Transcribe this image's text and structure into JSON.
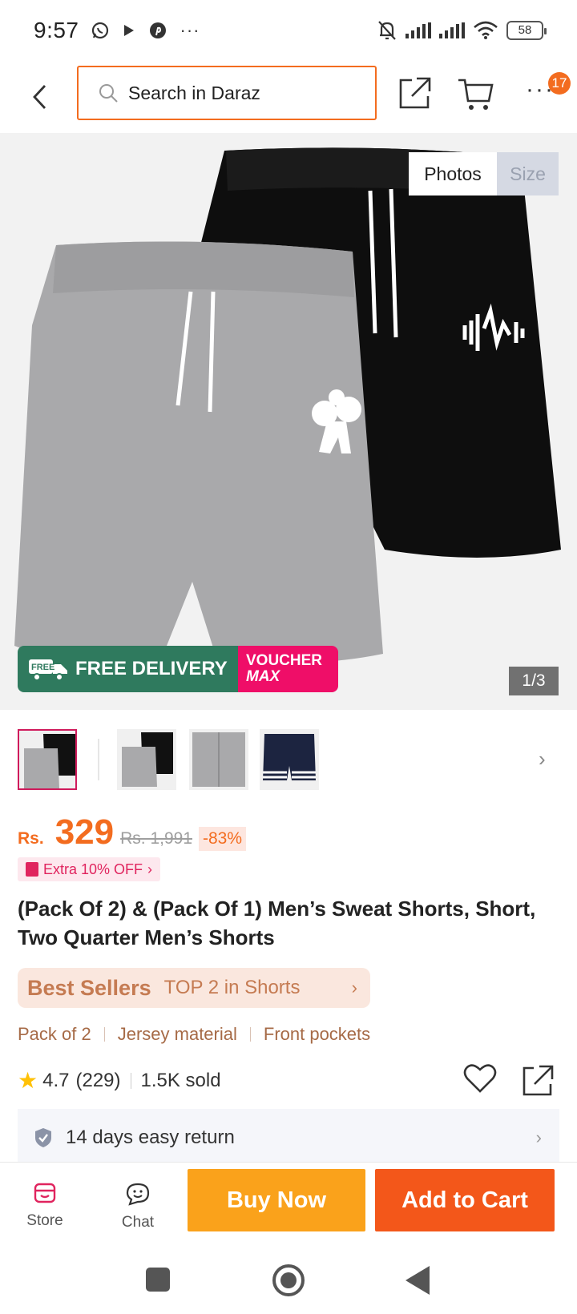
{
  "status": {
    "time": "9:57",
    "battery": "58"
  },
  "header": {
    "search_placeholder": "Search in Daraz",
    "cart_badge": "17",
    "more_label": "···"
  },
  "gallery": {
    "tabs": [
      "Photos",
      "Size"
    ],
    "counter": "1/3",
    "promo_free_tag": "FREE",
    "promo_free_delivery": "FREE DELIVERY",
    "promo_voucher": "VOUCHER",
    "promo_max": "MAX"
  },
  "price": {
    "currency": "Rs.",
    "value": "329",
    "original": "Rs. 1,991",
    "discount": "-83%"
  },
  "extra_offer": "Extra 10% OFF",
  "product_title": "(Pack Of 2) & (Pack Of 1) Men’s Sweat Shorts, Short, Two Quarter Men’s Shorts",
  "best_sellers": {
    "label": "Best Sellers",
    "rank": "TOP 2 in Shorts"
  },
  "tags": [
    "Pack of 2",
    "Jersey material",
    "Front pockets"
  ],
  "rating": {
    "score": "4.7",
    "count": "(229)",
    "sold": "1.5K sold"
  },
  "returns": "14 days easy return",
  "actions": {
    "store": "Store",
    "chat": "Chat",
    "buy_now": "Buy Now",
    "add_to_cart": "Add to Cart"
  },
  "colors": {
    "accent": "#f36c1f",
    "buy_now": "#faa21b",
    "add_to_cart": "#f3571a",
    "free_delivery": "#2f7a5e",
    "voucher": "#ef0e68"
  }
}
